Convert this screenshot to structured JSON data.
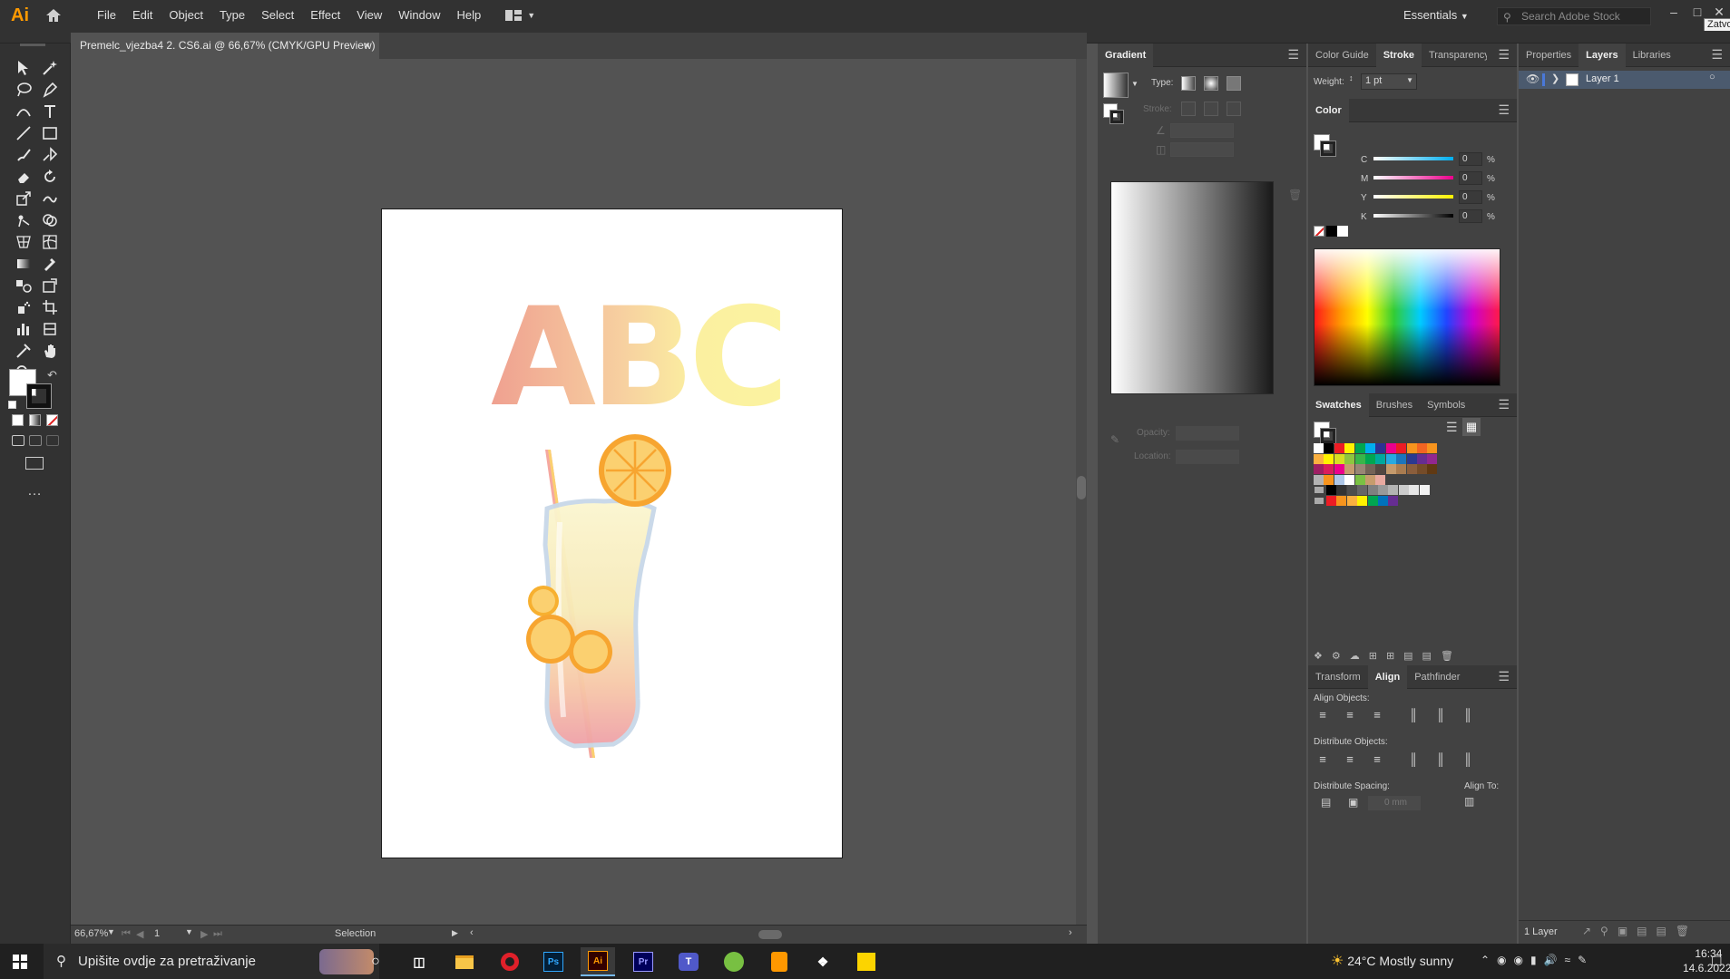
{
  "app": {
    "logo": "Ai"
  },
  "menu": [
    "File",
    "Edit",
    "Object",
    "Type",
    "Select",
    "Effect",
    "View",
    "Window",
    "Help"
  ],
  "workspace": {
    "name": "Essentials",
    "search_placeholder": "Search Adobe Stock",
    "tooltip": "Zatvo"
  },
  "document": {
    "tab_title": "Premelc_vjezba4 2. CS6.ai @ 66,67% (CMYK/GPU Preview)",
    "close": "×"
  },
  "artwork": {
    "letters": "ABC"
  },
  "statusbar": {
    "zoom": "66,67%",
    "page": "1",
    "tool": "Selection"
  },
  "gradient_panel": {
    "title": "Gradient",
    "type_label": "Type:",
    "stroke_label": "Stroke:",
    "opacity_label": "Opacity:",
    "location_label": "Location:"
  },
  "stroke_panel": {
    "tabs": [
      "Color Guide",
      "Stroke",
      "Transparency"
    ],
    "weight_label": "Weight:",
    "weight_value": "1 pt"
  },
  "color_panel": {
    "title": "Color",
    "channels": [
      {
        "name": "C",
        "value": "0",
        "unit": "%"
      },
      {
        "name": "M",
        "value": "0",
        "unit": "%"
      },
      {
        "name": "Y",
        "value": "0",
        "unit": "%"
      },
      {
        "name": "K",
        "value": "0",
        "unit": "%"
      }
    ]
  },
  "swatches_panel": {
    "tabs": [
      "Swatches",
      "Brushes",
      "Symbols"
    ]
  },
  "align_panel": {
    "tabs": [
      "Transform",
      "Align",
      "Pathfinder"
    ],
    "align_objects": "Align Objects:",
    "distribute_objects": "Distribute Objects:",
    "distribute_spacing": "Distribute Spacing:",
    "align_to": "Align To:",
    "spacing_value": "0 mm"
  },
  "layers_panel": {
    "tabs": [
      "Properties",
      "Layers",
      "Libraries"
    ],
    "layers": [
      {
        "name": "Layer 1"
      }
    ],
    "count": "1 Layer"
  },
  "taskbar": {
    "search_placeholder": "Upišite ovdje za pretraživanje",
    "weather": "24°C  Mostly sunny",
    "time": "16:34",
    "date": "14.6.2022."
  },
  "colors": {
    "swatch_rows": [
      [
        "#ffffff",
        "#000000",
        "#ed1c24",
        "#fff200",
        "#00a651",
        "#00aeef",
        "#2e3192",
        "#ec008c",
        "#ed1c24",
        "#f7941d",
        "#f26522",
        "#f7941d"
      ],
      [
        "#fbb040",
        "#fff200",
        "#d7df23",
        "#8dc63f",
        "#39b54a",
        "#00a651",
        "#00a99d",
        "#27aae1",
        "#1c75bc",
        "#2b3990",
        "#662d91",
        "#92278f"
      ],
      [
        "#9e1f63",
        "#da1c5c",
        "#ec008c",
        "#c69c6d",
        "#998675",
        "#736357",
        "#534741",
        "#c49a6c",
        "#a97c50",
        "#8b5e3c",
        "#754c29",
        "#603913"
      ],
      [
        "#b3b3b3",
        "#f7941d",
        "#aec7e8",
        "#ffffff",
        "#7ac143",
        "#c69c6d",
        "#e8a9a0"
      ],
      [
        "#000000",
        "#333333",
        "#4d4d4d",
        "#666666",
        "#808080",
        "#999999",
        "#b3b3b3",
        "#cccccc",
        "#e6e6e6",
        "#f2f2f2"
      ],
      [
        "#ed1c24",
        "#f7941d",
        "#fbb040",
        "#fff200",
        "#00a651",
        "#0072bc",
        "#662d91"
      ]
    ]
  }
}
